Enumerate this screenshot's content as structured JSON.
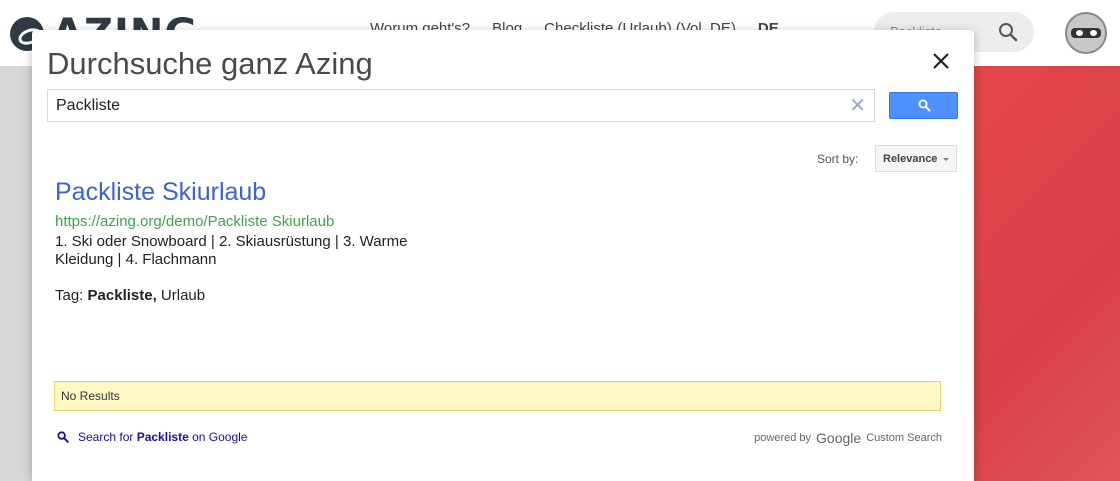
{
  "background": {
    "logo_text": "AZING",
    "nav_items": [
      "Worum geht's?",
      "Blog",
      "Checkliste (Urlaub) (Vol. DE)",
      "DE"
    ],
    "search_placeholder": "Packliste"
  },
  "modal": {
    "title": "Durchsuche ganz Azing",
    "search_value": "Packliste",
    "sort_label": "Sort by:",
    "sort_value": "Relevance"
  },
  "result": {
    "title": "Packliste Skiurlaub",
    "url": "https://azing.org/demo/Packliste Skiurlaub",
    "snippet": "1. Ski oder Snowboard | 2. Skiausrüstung | 3. Warme Kleidung | 4. Flachmann",
    "tag_prefix": "Tag:",
    "tag_bold": "Packliste,",
    "tag_rest": "Urlaub"
  },
  "no_results": "No Results",
  "footer": {
    "search_prefix": "Search for",
    "search_term": "Packliste",
    "search_suffix": "on Google",
    "powered_by": "powered by",
    "google": "Google",
    "custom_search": "Custom Search"
  },
  "colors": {
    "accent_blue": "#4d90fe",
    "result_title": "#3b61e3",
    "url_green": "#3ea64a",
    "no_results_bg": "#fff8c4",
    "red_panel": "#e3464a"
  }
}
